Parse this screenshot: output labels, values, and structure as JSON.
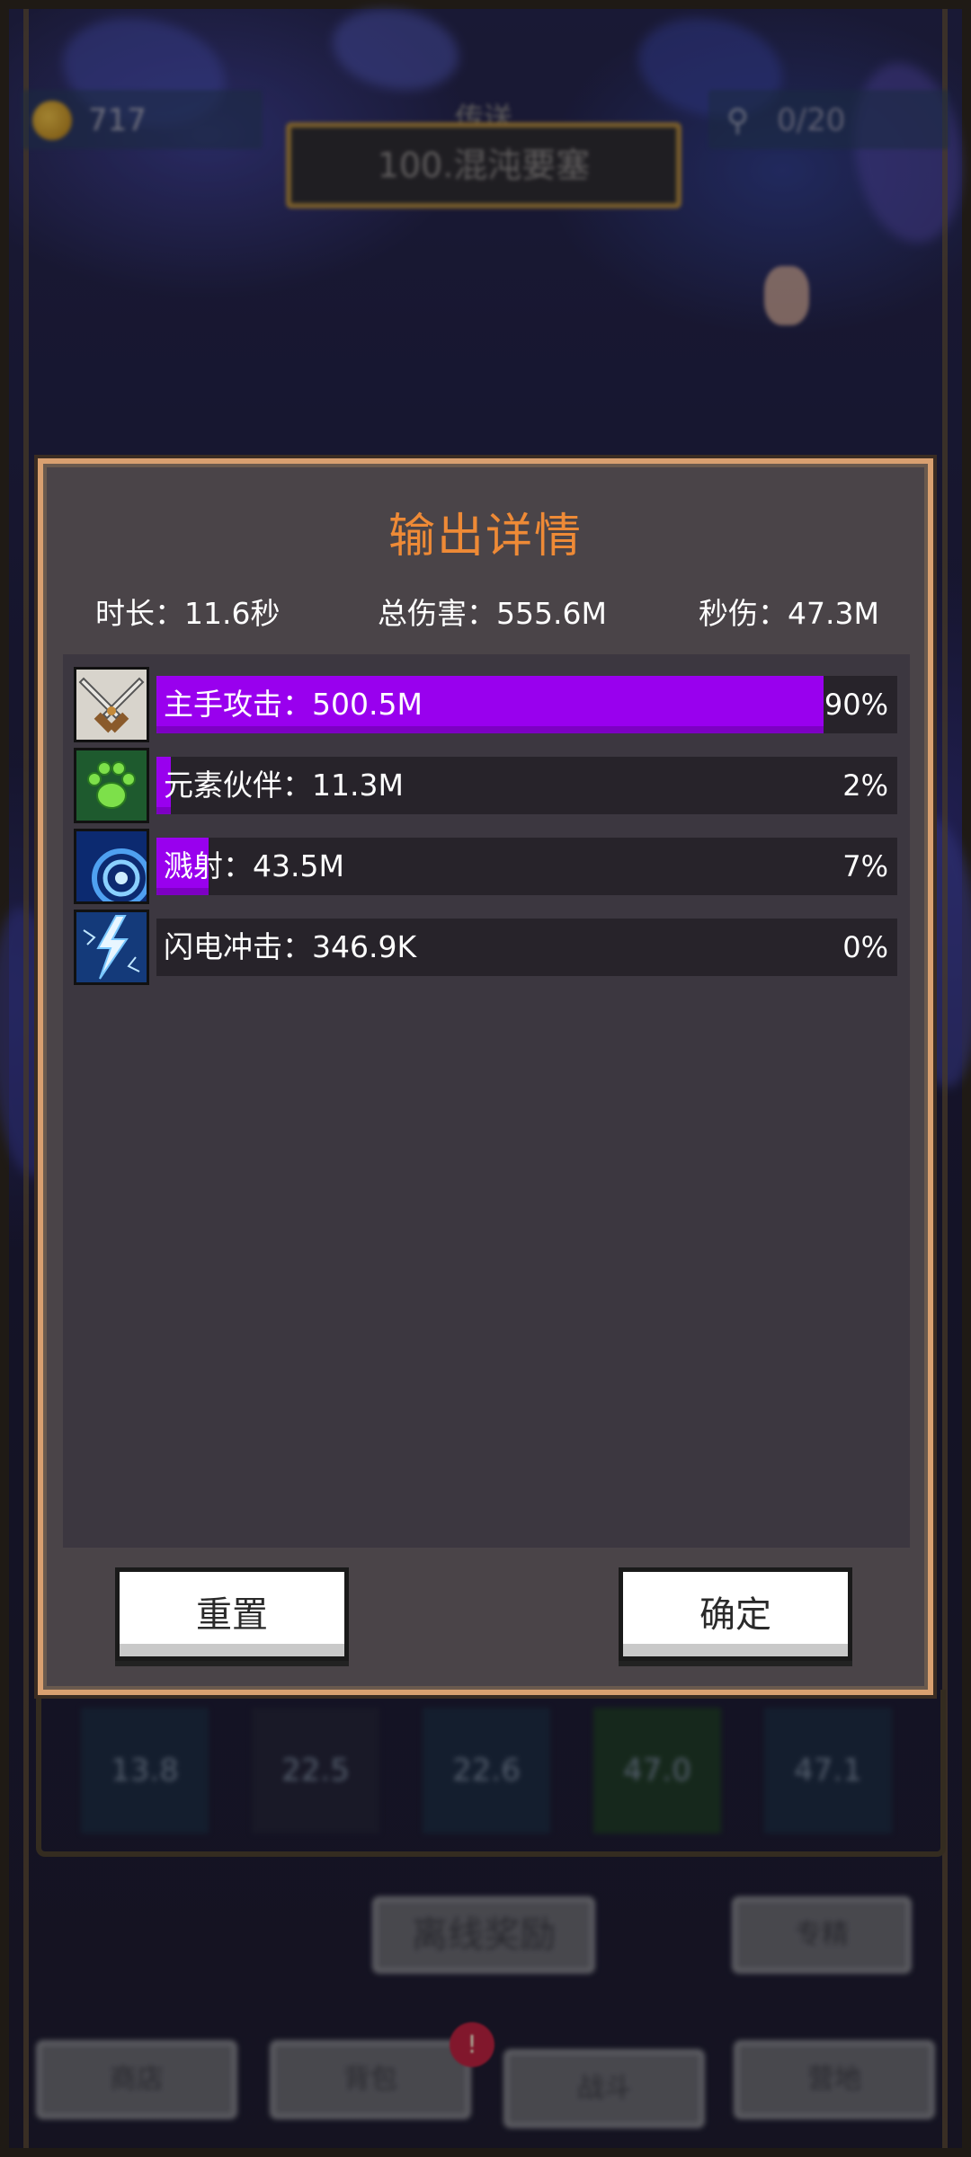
{
  "hud": {
    "gold": "717",
    "keys": "0/20",
    "stage_subtitle": "传送",
    "stage_name": "100.混沌要塞"
  },
  "background_skills": [
    "13.8",
    "22.5",
    "22.6",
    "47.0",
    "47.1"
  ],
  "background_buttons": {
    "offline_reward": "离线奖励",
    "special": "专精"
  },
  "bottom_nav": {
    "items": [
      "商店",
      "背包",
      "战斗",
      "营地"
    ],
    "badge": "!"
  },
  "modal": {
    "title": "输出详情",
    "duration_label": "时长：11.6秒",
    "total_damage_label": "总伤害：555.6M",
    "dps_label": "秒伤：47.3M",
    "rows": [
      {
        "name": "主手攻击：500.5M",
        "percent_text": "90%",
        "share": 0.9,
        "icon": "crossed-swords-icon"
      },
      {
        "name": "元素伙伴：11.3M",
        "percent_text": "2%",
        "share": 0.02,
        "icon": "green-paw-icon"
      },
      {
        "name": "溅射：43.5M",
        "percent_text": "7%",
        "share": 0.07,
        "icon": "blue-swirl-icon"
      },
      {
        "name": "闪电冲击：346.9K",
        "percent_text": "0%",
        "share": 0.0,
        "icon": "lightning-icon"
      }
    ],
    "reset_label": "重置",
    "confirm_label": "确定"
  },
  "colors": {
    "accent_title": "#ee8a36",
    "bar_fill": "#9900ee",
    "modal_border": "#d9a070"
  }
}
